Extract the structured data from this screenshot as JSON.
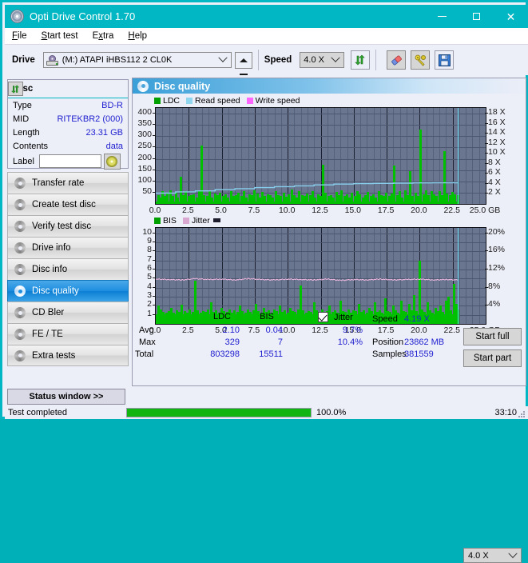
{
  "window": {
    "title": "Opti Drive Control 1.70",
    "icon": "disc-icon",
    "minimize": "minimize-icon",
    "maximize": "maximize-icon",
    "close": "close-icon"
  },
  "menu": {
    "items": [
      {
        "label": "File",
        "accel": "F"
      },
      {
        "label": "Start test",
        "accel": "S"
      },
      {
        "label": "Extra",
        "accel": "x"
      },
      {
        "label": "Help",
        "accel": "H"
      }
    ]
  },
  "toolbar": {
    "drive_label": "Drive",
    "drive_value": "(M:)   ATAPI iHBS112  2 CL0K",
    "eject_icon": "eject-icon",
    "speed_label": "Speed",
    "speed_value": "4.0 X",
    "refresh_icon": "refresh-icon",
    "eraser_icon": "eraser-icon",
    "tools_icon": "tools-icon",
    "save_icon": "save-icon"
  },
  "disc_panel": {
    "header": "Disc",
    "refresh_icon": "refresh-icon",
    "rows": [
      {
        "key": "Type",
        "value": "BD-R"
      },
      {
        "key": "MID",
        "value": "RITEKBR2 (000)"
      },
      {
        "key": "Length",
        "value": "23.31 GB"
      },
      {
        "key": "Contents",
        "value": "data"
      }
    ],
    "label_key": "Label",
    "label_value": "",
    "label_placeholder": "",
    "disc_button_icon": "cd-icon"
  },
  "sidebar": {
    "items": [
      {
        "label": "Transfer rate",
        "icon": "disc-transfer-icon",
        "active": false
      },
      {
        "label": "Create test disc",
        "icon": "disc-create-icon",
        "active": false
      },
      {
        "label": "Verify test disc",
        "icon": "disc-verify-icon",
        "active": false
      },
      {
        "label": "Drive info",
        "icon": "disc-drive-icon",
        "active": false
      },
      {
        "label": "Disc info",
        "icon": "disc-info-icon",
        "active": false
      },
      {
        "label": "Disc quality",
        "icon": "disc-quality-icon",
        "active": true
      },
      {
        "label": "CD Bler",
        "icon": "disc-bler-icon",
        "active": false
      },
      {
        "label": "FE / TE",
        "icon": "disc-fete-icon",
        "active": false
      },
      {
        "label": "Extra tests",
        "icon": "disc-extra-icon",
        "active": false
      }
    ],
    "status_window_button": "Status window >>"
  },
  "main": {
    "header": "Disc quality",
    "header_icon": "disc-quality-icon"
  },
  "stats": {
    "col_ldc": "LDC",
    "col_bis": "BIS",
    "jitter_label": "Jitter",
    "jitter_checked": true,
    "rows": [
      {
        "key": "Avg",
        "ldc": "2.10",
        "bis": "0.04",
        "jitter": "9.7%"
      },
      {
        "key": "Max",
        "ldc": "329",
        "bis": "7",
        "jitter": "10.4%"
      },
      {
        "key": "Total",
        "ldc": "803298",
        "bis": "15511",
        "jitter": ""
      }
    ],
    "speed_key": "Speed",
    "speed_value": "4.19 X",
    "position_key": "Position",
    "position_value": "23862 MB",
    "samples_key": "Samples",
    "samples_value": "381559",
    "speed_select": "4.0 X",
    "start_full": "Start full",
    "start_part": "Start part"
  },
  "statusbar": {
    "message": "Test completed",
    "progress_percent": "100.0%",
    "progress_value": 100,
    "elapsed": "33:10"
  },
  "colors": {
    "titlebar": "#00b7c3",
    "accent_blue": "#1f8fe0",
    "plot_bg": "#6a7690",
    "ldc_green": "#00c000",
    "read_speed_blue": "#66d9f2",
    "write_speed_pink": "#ff66ff",
    "bis_green": "#00c000",
    "jitter_pink": "#f0b8e0",
    "value_blue": "#1f1fd0",
    "progress_green": "#11b411"
  },
  "chart_data": [
    {
      "type": "bar",
      "title": "LDC / Read speed / Write speed",
      "xlabel": "GB",
      "ylabel": "LDC",
      "y2label": "X",
      "xlim": [
        0,
        25
      ],
      "ylim": [
        0,
        425
      ],
      "y2lim": [
        0,
        19.125
      ],
      "grid": true,
      "legend": [
        "LDC",
        "Read speed",
        "Write speed"
      ],
      "legend_colors": [
        "#00a000",
        "#87ceeb",
        "#ff66ff"
      ],
      "legend_position": "top-left",
      "xticks": [
        0.0,
        2.5,
        5.0,
        7.5,
        10.0,
        12.5,
        15.0,
        17.5,
        20.0,
        22.5,
        25.0
      ],
      "xticklabels": [
        "0.0",
        "2.5",
        "5.0",
        "7.5",
        "10.0",
        "12.5",
        "15.0",
        "17.5",
        "20.0",
        "22.5",
        "25.0 GB"
      ],
      "yticks": [
        50,
        100,
        150,
        200,
        250,
        300,
        350,
        400
      ],
      "y2ticks": [
        2,
        4,
        6,
        8,
        10,
        12,
        14,
        16,
        18
      ],
      "y2ticklabels": [
        "2 X",
        "4 X",
        "6 X",
        "8 X",
        "10 X",
        "12 X",
        "14 X",
        "16 X",
        "18 X"
      ],
      "cursor_x": 22.9,
      "series": [
        {
          "name": "LDC",
          "color": "#00c000",
          "kind": "bar",
          "x": [
            0.1,
            0.25,
            0.4,
            0.6,
            0.8,
            1.0,
            1.2,
            1.45,
            1.6,
            1.8,
            2.0,
            2.2,
            2.4,
            2.6,
            2.8,
            3.0,
            3.2,
            3.4,
            3.6,
            3.8,
            4.0,
            4.2,
            4.4,
            4.6,
            4.8,
            5.0,
            5.2,
            5.4,
            5.6,
            5.8,
            6.0,
            6.2,
            6.4,
            6.6,
            6.8,
            7.0,
            7.2,
            7.4,
            7.6,
            7.8,
            8.0,
            8.2,
            8.4,
            8.6,
            8.8,
            9.0,
            9.2,
            9.4,
            9.6,
            9.8,
            10.0,
            10.2,
            10.4,
            10.6,
            10.8,
            11.0,
            11.2,
            11.4,
            11.6,
            11.8,
            12.0,
            12.2,
            12.4,
            12.6,
            12.8,
            13.0,
            13.2,
            13.4,
            13.6,
            13.8,
            14.0,
            14.2,
            14.4,
            14.6,
            14.8,
            15.0,
            15.2,
            15.4,
            15.6,
            15.8,
            16.0,
            16.2,
            16.4,
            16.6,
            16.8,
            17.0,
            17.2,
            17.4,
            17.6,
            17.8,
            18.0,
            18.2,
            18.4,
            18.6,
            18.8,
            19.0,
            19.2,
            19.4,
            19.6,
            19.8,
            20.0,
            20.2,
            20.4,
            20.6,
            20.8,
            21.0,
            21.2,
            21.4,
            21.6,
            21.8,
            22.0,
            22.2,
            22.4,
            22.6,
            22.8
          ],
          "values": [
            40,
            30,
            55,
            35,
            45,
            60,
            35,
            48,
            30,
            120,
            40,
            55,
            35,
            38,
            42,
            30,
            55,
            260,
            40,
            35,
            60,
            30,
            45,
            38,
            50,
            34,
            42,
            30,
            58,
            35,
            40,
            48,
            36,
            55,
            30,
            42,
            38,
            60,
            45,
            30,
            52,
            36,
            44,
            38,
            30,
            56,
            40,
            35,
            48,
            32,
            42,
            62,
            38,
            30,
            55,
            40,
            34,
            46,
            38,
            58,
            30,
            42,
            36,
            175,
            48,
            34,
            40,
            30,
            52,
            38,
            60,
            34,
            44,
            30,
            48,
            36,
            56,
            42,
            30,
            38,
            52,
            34,
            44,
            30,
            58,
            40,
            36,
            50,
            34,
            46,
            170,
            38,
            55,
            30,
            60,
            40,
            144,
            36,
            50,
            34,
            329,
            42,
            60,
            38,
            55,
            44,
            36,
            58,
            40,
            235,
            46,
            38,
            52,
            44,
            40
          ]
        },
        {
          "name": "Read speed",
          "color": "#87ceeb",
          "kind": "step-line",
          "x": [
            0.0,
            1.5,
            3.0,
            4.5,
            6.0,
            7.5,
            9.0,
            10.5,
            12.0,
            13.5,
            15.0,
            16.5,
            18.0,
            19.5,
            21.0,
            22.5,
            22.9
          ],
          "values_x": [
            2.15,
            2.4,
            2.6,
            2.85,
            3.05,
            3.25,
            3.45,
            3.6,
            3.8,
            3.95,
            4.05,
            4.1,
            4.15,
            4.19,
            4.2,
            4.2,
            4.2
          ]
        },
        {
          "name": "Write speed",
          "color": "#ff66ff",
          "kind": "line",
          "x": [],
          "values": []
        }
      ]
    },
    {
      "type": "bar",
      "title": "BIS / Jitter",
      "xlabel": "GB",
      "ylabel": "BIS",
      "y2label": "%",
      "xlim": [
        0,
        25
      ],
      "ylim": [
        0,
        10.6
      ],
      "y2lim": [
        0,
        21.2
      ],
      "grid": true,
      "legend": [
        "BIS",
        "Jitter"
      ],
      "legend_colors": [
        "#00a000",
        "#e0a8d8"
      ],
      "legend_position": "top-left",
      "xticks": [
        0.0,
        2.5,
        5.0,
        7.5,
        10.0,
        12.5,
        15.0,
        17.5,
        20.0,
        22.5,
        25.0
      ],
      "xticklabels": [
        "0.0",
        "2.5",
        "5.0",
        "7.5",
        "10.0",
        "12.5",
        "15.0",
        "17.5",
        "20.0",
        "22.5",
        "25.0 GB"
      ],
      "yticks": [
        1,
        2,
        3,
        4,
        5,
        6,
        7,
        8,
        9,
        10
      ],
      "y2ticks": [
        4,
        8,
        12,
        16,
        20
      ],
      "y2ticklabels": [
        "4%",
        "8%",
        "12%",
        "16%",
        "20%"
      ],
      "cursor_x": 22.9,
      "series": [
        {
          "name": "BIS",
          "color": "#00c000",
          "kind": "bar",
          "x": [
            0.1,
            0.3,
            0.5,
            0.7,
            0.9,
            1.1,
            1.3,
            1.5,
            1.7,
            1.9,
            2.1,
            2.3,
            2.5,
            2.7,
            2.9,
            3.1,
            3.3,
            3.5,
            3.7,
            3.9,
            4.1,
            4.3,
            4.5,
            4.7,
            4.9,
            5.1,
            5.3,
            5.5,
            5.7,
            5.9,
            6.1,
            6.3,
            6.5,
            6.7,
            6.9,
            7.1,
            7.3,
            7.5,
            7.7,
            7.9,
            8.1,
            8.3,
            8.5,
            8.7,
            8.9,
            9.1,
            9.3,
            9.5,
            9.7,
            9.9,
            10.1,
            10.3,
            10.5,
            10.7,
            10.9,
            11.1,
            11.3,
            11.5,
            11.7,
            11.9,
            12.1,
            12.3,
            12.5,
            12.7,
            12.9,
            13.1,
            13.3,
            13.5,
            13.7,
            13.9,
            14.1,
            14.3,
            14.5,
            14.7,
            14.9,
            15.1,
            15.3,
            15.5,
            15.7,
            15.9,
            16.1,
            16.3,
            16.5,
            16.7,
            16.9,
            17.1,
            17.3,
            17.5,
            17.7,
            17.9,
            18.1,
            18.3,
            18.5,
            18.7,
            18.9,
            19.1,
            19.3,
            19.5,
            19.7,
            19.9,
            20.1,
            20.3,
            20.5,
            20.7,
            20.9,
            21.1,
            21.3,
            21.5,
            21.7,
            21.9,
            22.1,
            22.3,
            22.5,
            22.7,
            22.85
          ],
          "values": [
            2.0,
            1.6,
            1.3,
            1.2,
            1.4,
            1.8,
            1.2,
            1.5,
            1.3,
            2.1,
            1.4,
            1.2,
            1.6,
            1.3,
            4.8,
            1.5,
            1.2,
            1.4,
            1.3,
            1.6,
            2.4,
            1.3,
            1.5,
            1.2,
            1.8,
            1.4,
            1.3,
            1.6,
            1.2,
            1.5,
            1.3,
            2.0,
            1.4,
            1.2,
            1.6,
            1.3,
            1.5,
            2.2,
            1.4,
            1.2,
            1.8,
            1.3,
            1.5,
            1.2,
            1.6,
            1.4,
            2.0,
            1.3,
            1.5,
            1.2,
            1.8,
            1.4,
            1.3,
            1.6,
            4.2,
            1.5,
            1.2,
            1.4,
            1.3,
            2.4,
            1.5,
            1.2,
            1.6,
            1.3,
            1.4,
            2.0,
            1.3,
            1.5,
            1.2,
            2.6,
            1.4,
            1.3,
            1.6,
            1.2,
            1.5,
            1.4,
            2.2,
            1.3,
            1.5,
            1.2,
            1.8,
            1.4,
            2.4,
            1.3,
            1.5,
            1.2,
            2.8,
            1.4,
            1.3,
            2.0,
            1.5,
            1.2,
            2.6,
            1.4,
            1.3,
            2.2,
            1.5,
            3.2,
            1.4,
            7.0,
            1.6,
            1.3,
            2.4,
            1.5,
            1.2,
            1.8,
            1.4,
            2.0,
            1.3,
            2.6,
            3.0,
            1.5,
            4.4,
            2.2,
            1.6
          ]
        },
        {
          "name": "Jitter",
          "color": "#f0b8e0",
          "kind": "line",
          "x": [
            0.0,
            1.0,
            2.0,
            3.0,
            4.0,
            5.0,
            6.0,
            7.0,
            8.0,
            9.0,
            10.0,
            11.0,
            12.0,
            13.0,
            14.0,
            15.0,
            16.0,
            17.0,
            18.0,
            19.0,
            20.0,
            21.0,
            22.0,
            22.9
          ],
          "values": [
            9.9,
            9.8,
            9.7,
            10.0,
            9.8,
            9.9,
            9.7,
            10.0,
            9.8,
            9.7,
            9.9,
            9.8,
            9.7,
            9.9,
            9.6,
            9.8,
            9.7,
            9.9,
            9.7,
            9.8,
            9.9,
            9.7,
            9.8,
            9.7
          ]
        }
      ]
    }
  ]
}
